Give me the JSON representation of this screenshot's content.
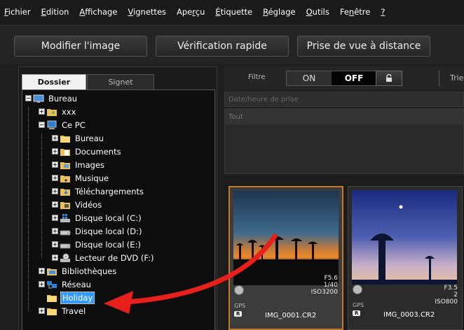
{
  "menubar": {
    "items": [
      {
        "label": "Fichier",
        "acc": "F",
        "rest": "ichier"
      },
      {
        "label": "Edition",
        "acc": "E",
        "rest": "dition"
      },
      {
        "label": "Affichage",
        "acc": "A",
        "rest": "ffichage"
      },
      {
        "label": "Vignettes",
        "acc": "V",
        "rest": "ignettes"
      },
      {
        "label": "Aperçu",
        "pre": "Ape",
        "acc": "r",
        "rest": "çu"
      },
      {
        "label": "Étiquette",
        "acc": "É",
        "rest": "tiquette"
      },
      {
        "label": "Réglage",
        "acc": "R",
        "rest": "églage"
      },
      {
        "label": "Outils",
        "acc": "O",
        "rest": "utils"
      },
      {
        "label": "Fenêtre",
        "pre": "Fe",
        "acc": "n",
        "rest": "être"
      },
      {
        "label": "?",
        "acc": "?",
        "rest": ""
      }
    ]
  },
  "toolbar": {
    "edit_image": "Modifier l'image",
    "quick_check": "Vérification rapide",
    "remote_shooting": "Prise de vue à distance"
  },
  "left_panel": {
    "tabs": {
      "folder": "Dossier",
      "bookmark": "Signet"
    },
    "tree": [
      {
        "label": "Bureau",
        "icon": "desktop-icon",
        "exp": "−"
      },
      {
        "label": "xxx",
        "icon": "user-folder-icon",
        "exp": "+"
      },
      {
        "label": "Ce PC",
        "icon": "computer-icon",
        "exp": "−"
      },
      {
        "label": "Bureau",
        "icon": "folder-icon",
        "exp": "+"
      },
      {
        "label": "Documents",
        "icon": "document-folder-icon",
        "exp": "+"
      },
      {
        "label": "Images",
        "icon": "pictures-folder-icon",
        "exp": "+"
      },
      {
        "label": "Musique",
        "icon": "music-folder-icon",
        "exp": "+"
      },
      {
        "label": "Téléchargements",
        "icon": "downloads-folder-icon",
        "exp": "+"
      },
      {
        "label": "Vidéos",
        "icon": "videos-folder-icon",
        "exp": "+"
      },
      {
        "label": "Disque local (C:)",
        "icon": "windows-drive-icon",
        "exp": "+"
      },
      {
        "label": "Disque local (D:)",
        "icon": "drive-icon",
        "exp": "+"
      },
      {
        "label": "Disque local (E:)",
        "icon": "drive-icon",
        "exp": "+"
      },
      {
        "label": "Lecteur de DVD (F:)",
        "icon": "dvd-drive-icon",
        "exp": "+"
      },
      {
        "label": "Bibliothèques",
        "icon": "libraries-icon",
        "exp": "+"
      },
      {
        "label": "Réseau",
        "icon": "network-icon",
        "exp": "+"
      },
      {
        "label": "Holiday",
        "icon": "folder-icon",
        "exp": ""
      },
      {
        "label": "Travel",
        "icon": "folder-icon",
        "exp": "+"
      }
    ]
  },
  "filter": {
    "label": "Filtre",
    "on": "ON",
    "off": "OFF",
    "sort_label": "Trie"
  },
  "date_field": {
    "placeholder": "Date/heure de prise"
  },
  "list": {
    "row_all": "Tout"
  },
  "thumbnails": [
    {
      "aperture": "F5.6",
      "shutter": "1/40",
      "iso": "ISO3200",
      "gps": "GPS",
      "raw": "R",
      "filename": "IMG_0001.CR2"
    },
    {
      "aperture": "F3.5",
      "shutter": "2",
      "iso": "ISO800",
      "gps": "GPS",
      "raw": "R",
      "filename": "IMG_0003.CR2"
    }
  ],
  "colors": {
    "selection": "#3399ff",
    "thumb_selected_border": "#c07a2a",
    "annotation_arrow": "#e8201c"
  }
}
